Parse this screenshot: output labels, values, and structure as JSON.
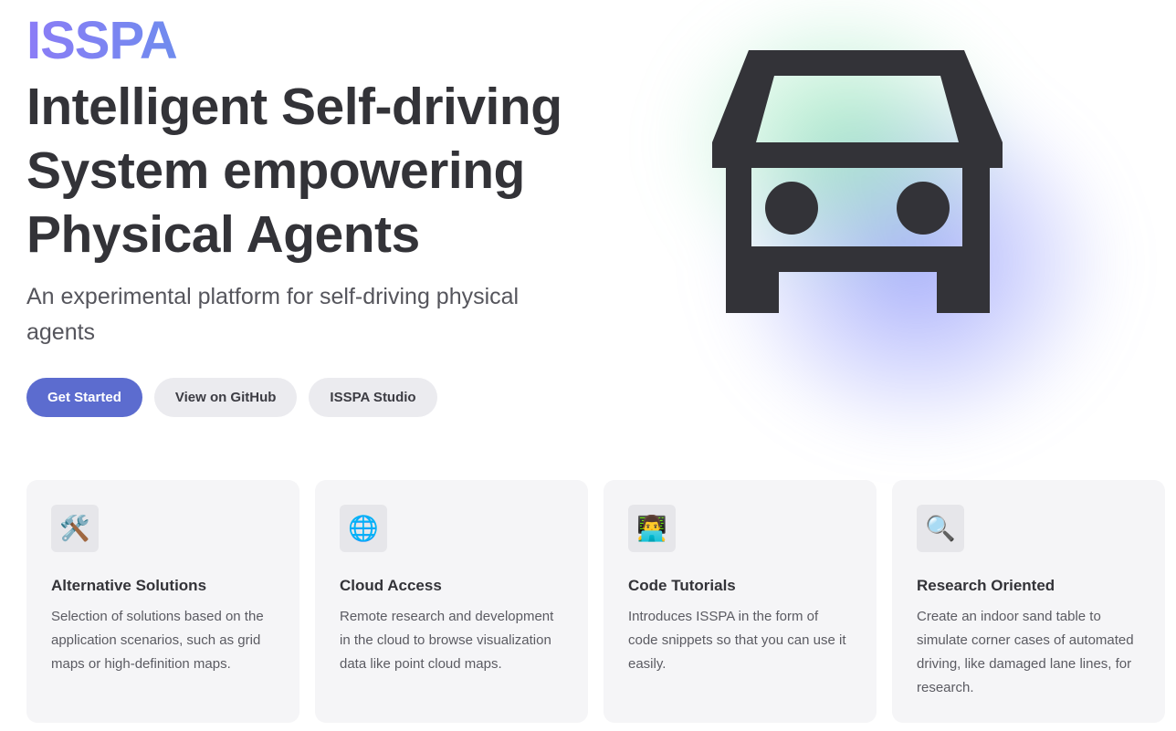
{
  "hero": {
    "brand": "ISSPA",
    "headline_lines": [
      "Intelligent Self-driving",
      "System empowering",
      "Physical Agents"
    ],
    "tagline": "An experimental platform for self-driving physical agents",
    "image_icon": "car-icon"
  },
  "actions": {
    "get_started": "Get Started",
    "github": "View on GitHub",
    "studio": "ISSPA Studio"
  },
  "features": [
    {
      "icon": "🛠️",
      "icon_name": "hammer-and-wrench-icon",
      "title": "Alternative Solutions",
      "desc": "Selection of solutions based on the application scenarios, such as grid maps or high-definition maps."
    },
    {
      "icon": "🌐",
      "icon_name": "globe-icon",
      "title": "Cloud Access",
      "desc": "Remote research and development in the cloud to browse visualization data like point cloud maps."
    },
    {
      "icon": "👨‍💻",
      "icon_name": "technologist-icon",
      "title": "Code Tutorials",
      "desc": "Introduces ISSPA in the form of code snippets so that you can use it easily."
    },
    {
      "icon": "🔍",
      "icon_name": "magnifier-icon",
      "title": "Research Oriented",
      "desc": "Create an indoor sand table to simulate corner cases of automated driving, like damaged lane lines, for research."
    }
  ],
  "colors": {
    "primary": "#5c6ccf",
    "text": "#333338",
    "brand_gradient": [
      "#8b7cf6",
      "#5b97e8",
      "#4cc6a2"
    ]
  }
}
